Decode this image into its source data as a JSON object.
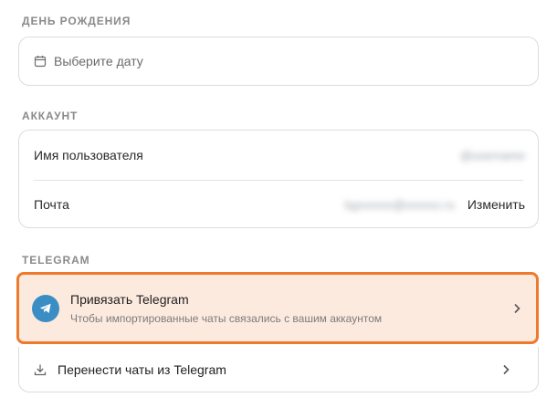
{
  "birthday": {
    "section_title": "ДЕНЬ РОЖДЕНИЯ",
    "placeholder": "Выберите дату",
    "icon": "calendar-icon"
  },
  "account": {
    "section_title": "АККАУНТ",
    "username_label": "Имя пользователя",
    "username_value": "@username",
    "email_label": "Почта",
    "email_value": "kgxxxxxx@xxxxxx.ru",
    "change_label": "Изменить"
  },
  "telegram": {
    "section_title": "TELEGRAM",
    "link_title": "Привязать Telegram",
    "link_subtitle": "Чтобы импортированные чаты связались с вашим аккаунтом",
    "transfer_label": "Перенести чаты из Telegram",
    "highlight_color": "#ee7a2b",
    "brand_color": "#3b8ec4"
  }
}
